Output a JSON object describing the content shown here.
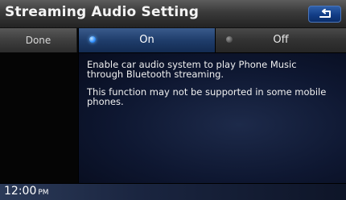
{
  "header": {
    "title": "Streaming Audio Setting",
    "back_icon": "back-arrow-icon"
  },
  "sidebar": {
    "done_label": "Done"
  },
  "options": {
    "on_label": "On",
    "off_label": "Off",
    "selected": "On"
  },
  "content": {
    "line1": "Enable car audio system to play Phone Music through Bluetooth streaming.",
    "line2": "This function may not be supported in some mobile phones."
  },
  "status": {
    "time": "12:00",
    "ampm": "PM"
  },
  "colors": {
    "accent": "#1f3d6b",
    "back_button": "#123d86"
  }
}
